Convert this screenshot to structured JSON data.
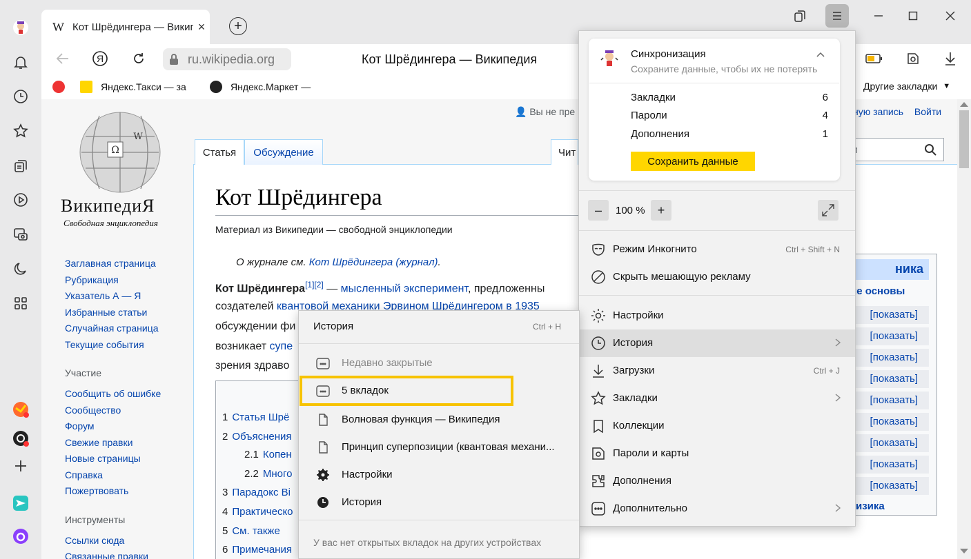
{
  "browser": {
    "tab_title": "Кот Шрёдингера — Википедия",
    "tab_favicon": "W",
    "address_domain": "ru.wikipedia.org",
    "page_title": "Кот Шрёдингера — Википедия",
    "bookmarks": [
      "Яндекс.Такси — за",
      "Яндекс.Маркет —"
    ],
    "other_bookmarks": "Другие закладки"
  },
  "sidebar_icons": [
    "alice-avatar-icon",
    "bell-icon",
    "clock-icon",
    "star-icon",
    "collections-icon",
    "play-icon",
    "screenshot-icon",
    "moon-icon",
    "apps-grid-icon",
    "yandex-music-icon",
    "yandex-disk-icon",
    "add-icon",
    "messenger-icon",
    "alice-icon"
  ],
  "wiki": {
    "logo_name": "ВикипедиЯ",
    "logo_sub": "Свободная энциклопедия",
    "nav_main": [
      "Заглавная страница",
      "Рубрикация",
      "Указатель А — Я",
      "Избранные статьи",
      "Случайная страница",
      "Текущие события"
    ],
    "nav_participation_title": "Участие",
    "nav_participation": [
      "Сообщить об ошибке",
      "Сообщество",
      "Форум",
      "Свежие правки",
      "Новые страницы",
      "Справка",
      "Пожертвовать"
    ],
    "nav_tools_title": "Инструменты",
    "nav_tools": [
      "Ссылки сюда",
      "Связанные правки"
    ],
    "tab_article": "Статья",
    "tab_talk": "Обсуждение",
    "tab_read": "Чит",
    "user_not_logged": "Вы не пре",
    "user_create": "ную запись",
    "user_login": "Войти",
    "search_placeholder": "ии",
    "title": "Кот Шрёдингера",
    "from": "Материал из Википедии — свободной энциклопедии",
    "hatnote_prefix": "О журнале см.",
    "hatnote_link": "Кот Шрёдингера (журнал)",
    "hatnote_suffix": ".",
    "para": {
      "line1_bold": "Кот Шрёдингера",
      "line1_refs": "[1][2]",
      "line1_link1": "мысленный",
      "line1_link2": "эксперимент",
      "line1_text": ", предложенны",
      "line2_text": "создателей",
      "line2_link": "квантовой механики Эрвином Шрёдингером в 1935",
      "line3_text": "обсуждении фи",
      "line4_text": "возникает",
      "line4_link": "супе",
      "line5_text": "зрения здраво"
    },
    "toc": [
      {
        "num": "1",
        "text": "Статья Шрё"
      },
      {
        "num": "2",
        "text": "Объяснения"
      },
      {
        "num": "2.1",
        "text": "Копен"
      },
      {
        "num": "2.2",
        "text": "Много"
      },
      {
        "num": "3",
        "text": "Парадокс Ві"
      },
      {
        "num": "4",
        "text": "Практическо"
      },
      {
        "num": "5",
        "text": "См. также"
      },
      {
        "num": "6",
        "text": "Примечания"
      }
    ],
    "infobox_head": "ника",
    "infobox_sub": "ие основы",
    "infobox_show": "[показать]",
    "infobox_foot": "изика"
  },
  "main_menu": {
    "sync_title": "Синхронизация",
    "sync_sub": "Сохраните данные, чтобы их не потерять",
    "sync_rows": [
      {
        "label": "Закладки",
        "count": "6"
      },
      {
        "label": "Пароли",
        "count": "4"
      },
      {
        "label": "Дополнения",
        "count": "1"
      }
    ],
    "save_button": "Сохранить данные",
    "zoom": "100 %",
    "zoom_minus": "–",
    "zoom_plus": "+",
    "items": [
      {
        "label": "Режим Инкогнито",
        "shortcut": "Ctrl + Shift + N",
        "icon": "incognito-icon"
      },
      {
        "label": "Скрыть мешающую рекламу",
        "shortcut": "",
        "icon": "block-ads-icon"
      },
      {
        "label": "Настройки",
        "shortcut": "",
        "icon": "settings-gear-icon"
      },
      {
        "label": "История",
        "shortcut": "",
        "icon": "history-clock-icon"
      },
      {
        "label": "Загрузки",
        "shortcut": "Ctrl + J",
        "icon": "download-icon"
      },
      {
        "label": "Закладки",
        "shortcut": "",
        "icon": "bookmark-star-icon"
      },
      {
        "label": "Коллекции",
        "shortcut": "",
        "icon": "collections-icon"
      },
      {
        "label": "Пароли и карты",
        "shortcut": "",
        "icon": "passwords-icon"
      },
      {
        "label": "Дополнения",
        "shortcut": "",
        "icon": "extensions-icon"
      },
      {
        "label": "Дополнительно",
        "shortcut": "",
        "icon": "more-icon"
      }
    ]
  },
  "history_menu": {
    "header": "История",
    "shortcut": "Ctrl + H",
    "recently_closed": "Недавно закрытые",
    "tabs_group": "5 вкладок",
    "items": [
      "Волновая функция — Википедия",
      "Принцип суперпозиции (квантовая механи..."
    ],
    "settings": "Настройки",
    "history": "История",
    "footer": "У вас нет открытых вкладок на других устройствах"
  },
  "colors": {
    "accent_yellow": "#ffd600",
    "highlight_border": "#f7c300",
    "wiki_link": "#0645ad"
  }
}
